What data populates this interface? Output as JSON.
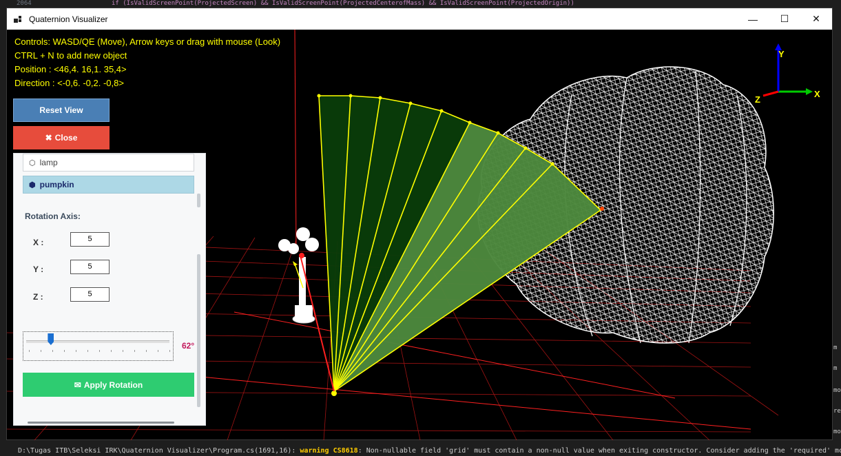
{
  "editor": {
    "line_number": "2064",
    "code_line": "if (IsValidScreenPoint(ProjectedScreen) && IsValidScreenPoint(ProjectedCenterofMass) && IsValidScreenPoint(ProjectedOrigin))"
  },
  "window": {
    "title": "Quaternion Visualizer",
    "minimize_glyph": "—",
    "maximize_glyph": "☐",
    "close_glyph": "✕"
  },
  "hud": {
    "controls": "Controls: WASD/QE (Move), Arrow keys or drag with mouse (Look)",
    "add_object": "CTRL + N to add new object",
    "position": "Position : <46,4. 16,1. 35,4>",
    "direction": "Direction : <-0,6. -0,2. -0,8>"
  },
  "buttons": {
    "reset_view": "Reset View",
    "close": "Close",
    "close_icon": "✖"
  },
  "objects": {
    "items": [
      {
        "name": "lamp",
        "icon": "cube-icon"
      },
      {
        "name": "pumpkin",
        "icon": "cube-icon"
      }
    ],
    "selected": "pumpkin"
  },
  "rotation": {
    "axis_label": "Rotation Axis:",
    "x_label": "X :",
    "y_label": "Y :",
    "z_label": "Z :",
    "x": "5",
    "y": "5",
    "z": "5",
    "angle_text": "62°",
    "angle_fraction": 0.17,
    "apply_label": "Apply Rotation",
    "apply_icon": "✉"
  },
  "gizmo": {
    "x_label": "X",
    "y_label": "Y",
    "z_label": "Z",
    "x_color": "#00cc00",
    "y_color": "#0000ff",
    "z_color": "#ff0000"
  },
  "colors": {
    "hud_text": "#ffff00",
    "reset_button": "#4a7fb5",
    "close_button": "#e74c3c",
    "apply_button": "#2ecc71",
    "selected_item": "#add8e6",
    "angle_value": "#c2185b",
    "grid": "#d61a1a",
    "fan_fill": "#0a3d0a",
    "fan_edge": "#ffff00"
  },
  "status": {
    "path": "D:\\Tugas ITB\\Seleksi IRK\\Quaternion Visualizer\\Program.cs(1691,16): ",
    "warning_code": "warning CS8618",
    "message": ": Non-nullable field 'grid' must contain a non-null value when exiting constructor. Consider adding the 'required' mo"
  },
  "side_output": [
    "m",
    "m",
    "mo",
    "re",
    "mo"
  ]
}
